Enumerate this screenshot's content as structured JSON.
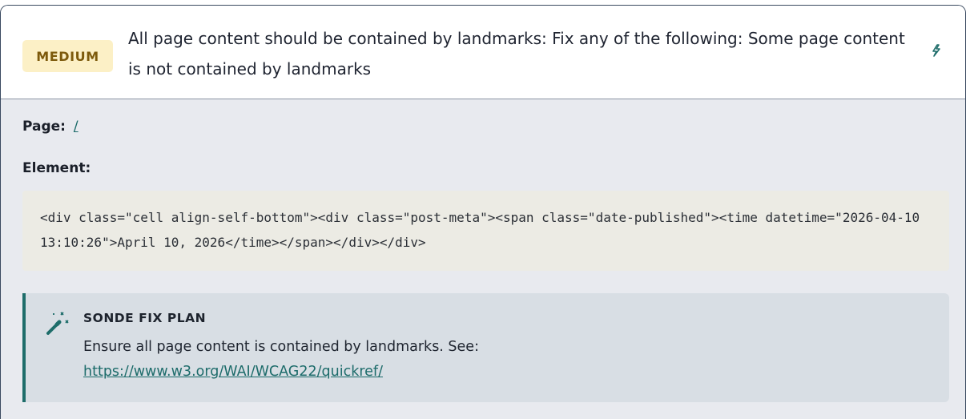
{
  "issue": {
    "severity": "MEDIUM",
    "title": "All page content should be contained by landmarks: Fix any of the following: Some page content is not contained by landmarks",
    "edit_icon": "magic-wand-icon"
  },
  "details": {
    "page_label": "Page:",
    "page_link": "/",
    "element_label": "Element:",
    "element_code": "<div class=\"cell align-self-bottom\"><div class=\"post-meta\"><span class=\"date-published\"><time datetime=\"2026-04-10 13:10:26\">April 10, 2026</time></span></div></div>"
  },
  "fix_plan": {
    "icon": "magic-wand-sparkle-icon",
    "title": "SONDE FIX PLAN",
    "text": "Ensure all page content is contained by landmarks. See:",
    "link": "https://www.w3.org/WAI/WCAG22/quickref/"
  },
  "colors": {
    "accent": "#1e6d6a",
    "badge_bg": "#fcf0c6",
    "badge_text": "#7d5a0c",
    "body_bg": "#e8eaef",
    "code_bg": "#ecebe4",
    "fix_bg": "#d8dee4"
  }
}
